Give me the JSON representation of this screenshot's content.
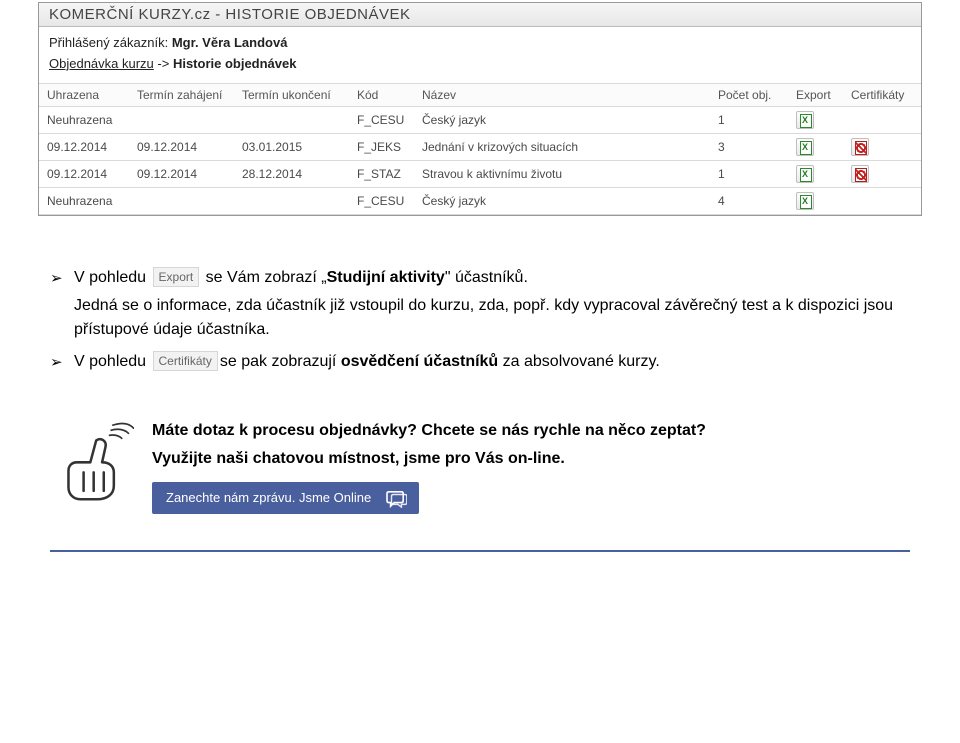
{
  "window": {
    "title": "KOMERČNÍ KURZY.cz - HISTORIE OBJEDNÁVEK"
  },
  "meta": {
    "logged_prefix": "Přihlášený zákazník: ",
    "logged_name": "Mgr. Věra Landová",
    "crumb_link": "Objednávka kurzu",
    "crumb_sep": " -> ",
    "crumb_current": "Historie objednávek"
  },
  "table": {
    "headers": {
      "uhrazena": "Uhrazena",
      "zahajeni": "Termín zahájení",
      "ukonceni": "Termín ukončení",
      "kod": "Kód",
      "nazev": "Název",
      "pocet": "Počet obj.",
      "export": "Export",
      "cert": "Certifikáty"
    },
    "rows": [
      {
        "uhrazena": "Neuhrazena",
        "zahajeni": "",
        "ukonceni": "",
        "kod": "F_CESU",
        "nazev": "Český jazyk",
        "pocet": "1",
        "has_cert": false
      },
      {
        "uhrazena": "09.12.2014",
        "zahajeni": "09.12.2014",
        "ukonceni": "03.01.2015",
        "kod": "F_JEKS",
        "nazev": "Jednání v krizových situacích",
        "pocet": "3",
        "has_cert": true
      },
      {
        "uhrazena": "09.12.2014",
        "zahajeni": "09.12.2014",
        "ukonceni": "28.12.2014",
        "kod": "F_STAZ",
        "nazev": "Stravou k aktivnímu životu",
        "pocet": "1",
        "has_cert": true
      },
      {
        "uhrazena": "Neuhrazena",
        "zahajeni": "",
        "ukonceni": "",
        "kod": "F_CESU",
        "nazev": "Český jazyk",
        "pocet": "4",
        "has_cert": false
      }
    ]
  },
  "body": {
    "chip_export": "Export",
    "chip_cert": "Certifikáty",
    "line1_a": "V pohledu ",
    "line1_b": " se Vám zobrazí „",
    "line1_bold": "Studijní aktivity",
    "line1_c": "\" účastníků.",
    "line2": "Jedná se o informace, zda účastník již vstoupil do kurzu, zda, popř. kdy vypracoval závěrečný test a k dispozici jsou přístupové údaje účastníka.",
    "line3_a": "V pohledu ",
    "line3_b": "se pak zobrazují ",
    "line3_bold": "osvědčení účastníků",
    "line3_c": " za absolvované kurzy."
  },
  "contact": {
    "q1": "Máte dotaz k procesu objednávky? Chcete se nás rychle na něco zeptat?",
    "q2": "Využijte naši chatovou místnost, jsme pro Vás on-line.",
    "chat_label": "Zanechte nám zprávu. Jsme Online"
  }
}
